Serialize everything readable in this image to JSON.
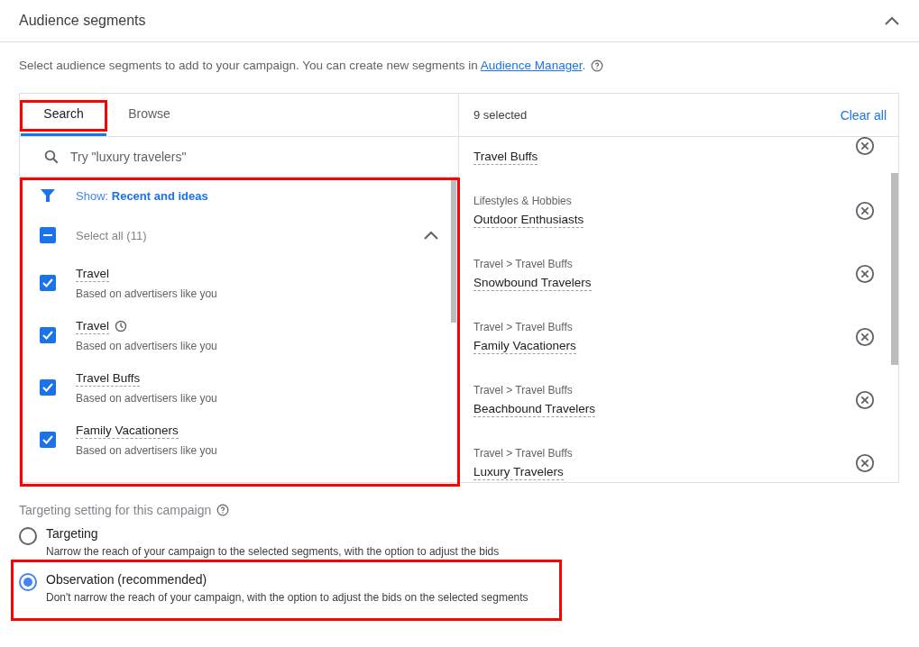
{
  "section": {
    "title": "Audience segments",
    "expanded": true
  },
  "description": {
    "text": "Select audience segments to add to your campaign. You can create new segments in ",
    "link": "Audience Manager",
    "tail": "."
  },
  "tabs": [
    {
      "label": "Search",
      "selected": true,
      "highlighted": true
    },
    {
      "label": "Browse",
      "selected": false,
      "highlighted": false
    }
  ],
  "search": {
    "placeholder": "Try \"luxury travelers\""
  },
  "results": {
    "highlighted": true,
    "filter": {
      "label": "Show:",
      "value": "Recent and ideas"
    },
    "select_all": {
      "label": "Select all (11)",
      "indeterminate": true,
      "expanded": true
    },
    "items": [
      {
        "name": "Travel",
        "note": "Based on advertisers like you",
        "checked": true,
        "recent": false
      },
      {
        "name": "Travel",
        "note": "Based on advertisers like you",
        "checked": true,
        "recent": true
      },
      {
        "name": "Travel Buffs",
        "note": "Based on advertisers like you",
        "checked": true,
        "recent": false
      },
      {
        "name": "Family Vacationers",
        "note": "Based on advertisers like you",
        "checked": true,
        "recent": false
      }
    ]
  },
  "selected_panel": {
    "count": "9 selected",
    "clear": "Clear all",
    "items": [
      {
        "name": "Travel Buffs"
      },
      {
        "path": "Lifestyles & Hobbies",
        "name": "Outdoor Enthusiasts"
      },
      {
        "path": "Travel > Travel Buffs",
        "name": "Snowbound Travelers"
      },
      {
        "path": "Travel > Travel Buffs",
        "name": "Family Vacationers"
      },
      {
        "path": "Travel > Travel Buffs",
        "name": "Beachbound Travelers"
      },
      {
        "path": "Travel > Travel Buffs",
        "name": "Luxury Travelers"
      }
    ]
  },
  "targeting": {
    "label": "Targeting setting for this campaign",
    "options": [
      {
        "title": "Targeting",
        "text": "Narrow the reach of your campaign to the selected segments, with the option to adjust the bids",
        "selected": false,
        "highlighted": false
      },
      {
        "title": "Observation (recommended)",
        "text": "Don't narrow the reach of your campaign, with the option to adjust the bids on the selected segments",
        "selected": true,
        "highlighted": true
      }
    ]
  }
}
